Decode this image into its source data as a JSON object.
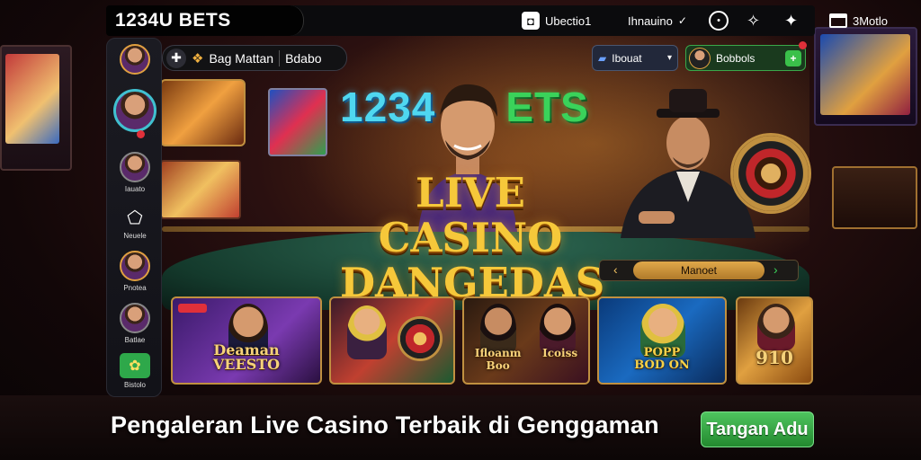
{
  "brand": {
    "name": "1234U BETS"
  },
  "topbar": {
    "items": [
      {
        "label": "Ubectio1",
        "icon": "app-icon"
      },
      {
        "label": "Ihnauino",
        "icon": "chevron-icon"
      },
      {
        "label": "",
        "icon": "chat-icon"
      },
      {
        "label": "",
        "icon": "spark-icon"
      },
      {
        "label": "",
        "icon": "globe-icon"
      },
      {
        "label": "3Motlo",
        "icon": "window-icon"
      }
    ]
  },
  "search": {
    "left_label": "Bag Mattan",
    "right_label": "Bdabo"
  },
  "account": {
    "balance_label": "Ibouat",
    "deposit_label": "Bobbols"
  },
  "sidebar": {
    "items": [
      {
        "label": "",
        "type": "avatar"
      },
      {
        "label": "",
        "type": "avatar-big"
      },
      {
        "label": "Iauato",
        "type": "avatar"
      },
      {
        "label": "Neuele",
        "type": "icon"
      },
      {
        "label": "Pnotea",
        "type": "avatar"
      },
      {
        "label": "Batlae",
        "type": "avatar"
      },
      {
        "label": "Bistolo",
        "type": "green"
      }
    ]
  },
  "hero": {
    "logo_left": "1234",
    "logo_right": "ETS",
    "title_line1": "LIVE CASINO",
    "title_line2": "DANGEDAS"
  },
  "market": {
    "label": "Manoet"
  },
  "cards": [
    {
      "label_line1": "Deaman",
      "label_line2": "VEESTO"
    },
    {
      "label_line1": "",
      "label_line2": ""
    },
    {
      "label_line1": "Ifloanm",
      "label_line2": "Boo"
    },
    {
      "label_line1": "Icoiss",
      "label_line2": ""
    },
    {
      "label_line1": "POPP",
      "label_line2": "BOD ON"
    },
    {
      "label_line1": "910",
      "label_line2": ""
    }
  ],
  "footer": {
    "caption": "Pengaleran Live Casino Terbaik di Genggaman",
    "cta": "Tangan Adu"
  },
  "colors": {
    "accent_gold": "#f6c83a",
    "accent_green": "#2ea84a",
    "logo_blue": "#4fd7f0"
  }
}
